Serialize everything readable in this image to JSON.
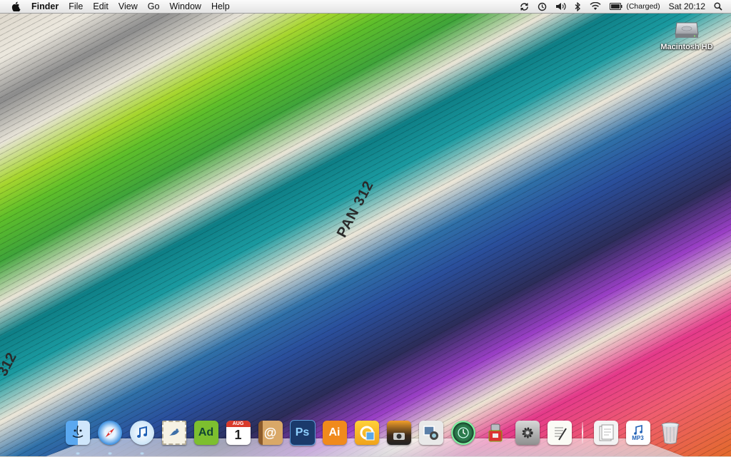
{
  "menubar": {
    "apple_icon": "apple-logo-icon",
    "app_name": "Finder",
    "menus": [
      "File",
      "Edit",
      "View",
      "Go",
      "Window",
      "Help"
    ],
    "status": {
      "sync_icon": "sync-icon",
      "time_machine_icon": "time-machine-icon",
      "volume_icon": "volume-icon",
      "bluetooth_icon": "bluetooth-icon",
      "wifi_icon": "wifi-icon",
      "battery_icon": "battery-icon",
      "battery_text": "(Charged)",
      "clock": "Sat 20:12",
      "spotlight_icon": "spotlight-search-icon"
    }
  },
  "desktop": {
    "drive_label": "Macintosh HD",
    "wallpaper_text_1": "PAN 312",
    "wallpaper_text_2": "312"
  },
  "dock": {
    "items": [
      {
        "name": "finder",
        "label": ""
      },
      {
        "name": "safari",
        "label": ""
      },
      {
        "name": "itunes",
        "label": ""
      },
      {
        "name": "mail-stamp",
        "label": ""
      },
      {
        "name": "adobe-dreamweaver",
        "label": "Ad"
      },
      {
        "name": "ical",
        "label": "1",
        "month": "AUG"
      },
      {
        "name": "address-book",
        "label": "@"
      },
      {
        "name": "photoshop",
        "label": "Ps"
      },
      {
        "name": "illustrator",
        "label": "Ai"
      },
      {
        "name": "preview-app",
        "label": ""
      },
      {
        "name": "iphoto",
        "label": ""
      },
      {
        "name": "photo-booth",
        "label": ""
      },
      {
        "name": "time-machine",
        "label": ""
      },
      {
        "name": "automator",
        "label": ""
      },
      {
        "name": "system-preferences",
        "label": ""
      },
      {
        "name": "textedit",
        "label": ""
      }
    ],
    "right_items": [
      {
        "name": "documents-stack",
        "label": ""
      },
      {
        "name": "mp3-file",
        "label": "MP3"
      },
      {
        "name": "trash",
        "label": ""
      }
    ],
    "colors": {
      "photoshop": "#1b3a6b",
      "illustrator": "#f08a1c",
      "dreamweaver": "#7dbf2f"
    }
  }
}
